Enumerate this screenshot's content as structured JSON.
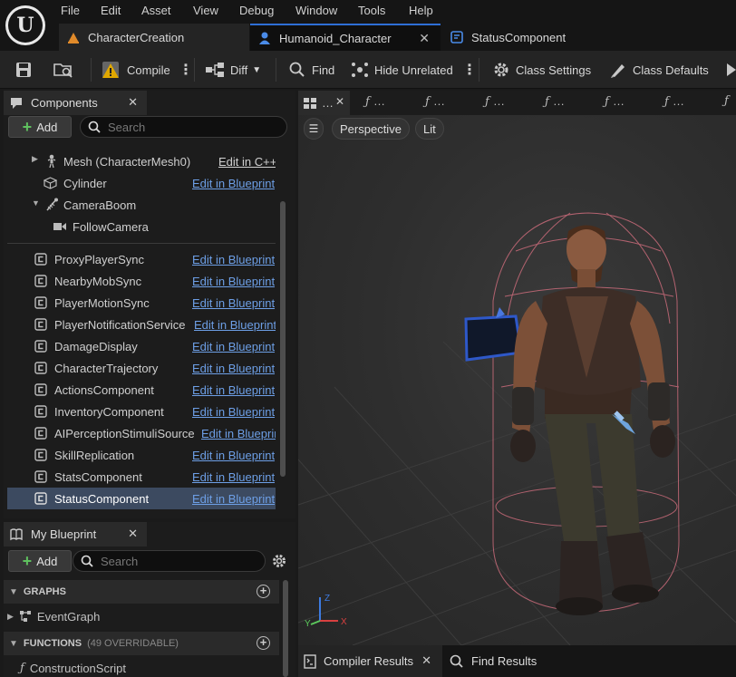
{
  "menu": [
    "File",
    "Edit",
    "Asset",
    "View",
    "Debug",
    "Window",
    "Tools",
    "Help"
  ],
  "tabs": [
    {
      "label": "CharacterCreation"
    },
    {
      "label": "Humanoid_Character"
    },
    {
      "label": "StatusComponent"
    }
  ],
  "toolbar": {
    "compile": "Compile",
    "diff": "Diff",
    "find": "Find",
    "hide_unrelated": "Hide Unrelated",
    "class_settings": "Class Settings",
    "class_defaults": "Class Defaults"
  },
  "components": {
    "title": "Components",
    "add_label": "Add",
    "search_placeholder": "Search",
    "tree": [
      {
        "name": "Mesh (CharacterMesh0)",
        "action": "Edit in C++"
      },
      {
        "name": "Cylinder",
        "action": "Edit in Blueprint"
      },
      {
        "name": "CameraBoom",
        "action": ""
      },
      {
        "name": "FollowCamera",
        "action": ""
      }
    ],
    "items": [
      {
        "name": "ProxyPlayerSync",
        "action": "Edit in Blueprint"
      },
      {
        "name": "NearbyMobSync",
        "action": "Edit in Blueprint"
      },
      {
        "name": "PlayerMotionSync",
        "action": "Edit in Blueprint"
      },
      {
        "name": "PlayerNotificationService",
        "action": "Edit in Blueprint"
      },
      {
        "name": "DamageDisplay",
        "action": "Edit in Blueprint"
      },
      {
        "name": "CharacterTrajectory",
        "action": "Edit in Blueprint"
      },
      {
        "name": "ActionsComponent",
        "action": "Edit in Blueprint"
      },
      {
        "name": "InventoryComponent",
        "action": "Edit in Blueprint"
      },
      {
        "name": "AIPerceptionStimuliSource",
        "action": "Edit in Blueprint"
      },
      {
        "name": "SkillReplication",
        "action": "Edit in Blueprint"
      },
      {
        "name": "StatsComponent",
        "action": "Edit in Blueprint"
      },
      {
        "name": "StatusComponent",
        "action": "Edit in Blueprint"
      }
    ]
  },
  "my_blueprint": {
    "title": "My Blueprint",
    "add_label": "Add",
    "search_placeholder": "Search",
    "graphs_label": "GRAPHS",
    "graph_item": "EventGraph",
    "functions_label": "FUNCTIONS",
    "functions_count": "(49 OVERRIDABLE)",
    "function_item": "ConstructionScript"
  },
  "viewport": {
    "perspective": "Perspective",
    "lit": "Lit"
  },
  "bottom_tabs": {
    "compiler_results": "Compiler Results",
    "find_results": "Find Results"
  },
  "colors": {
    "accent_blue": "#2e6fd6",
    "link_blue": "#6d9fe6",
    "add_green": "#5fc15f",
    "compile_warning": "#e0a800"
  }
}
